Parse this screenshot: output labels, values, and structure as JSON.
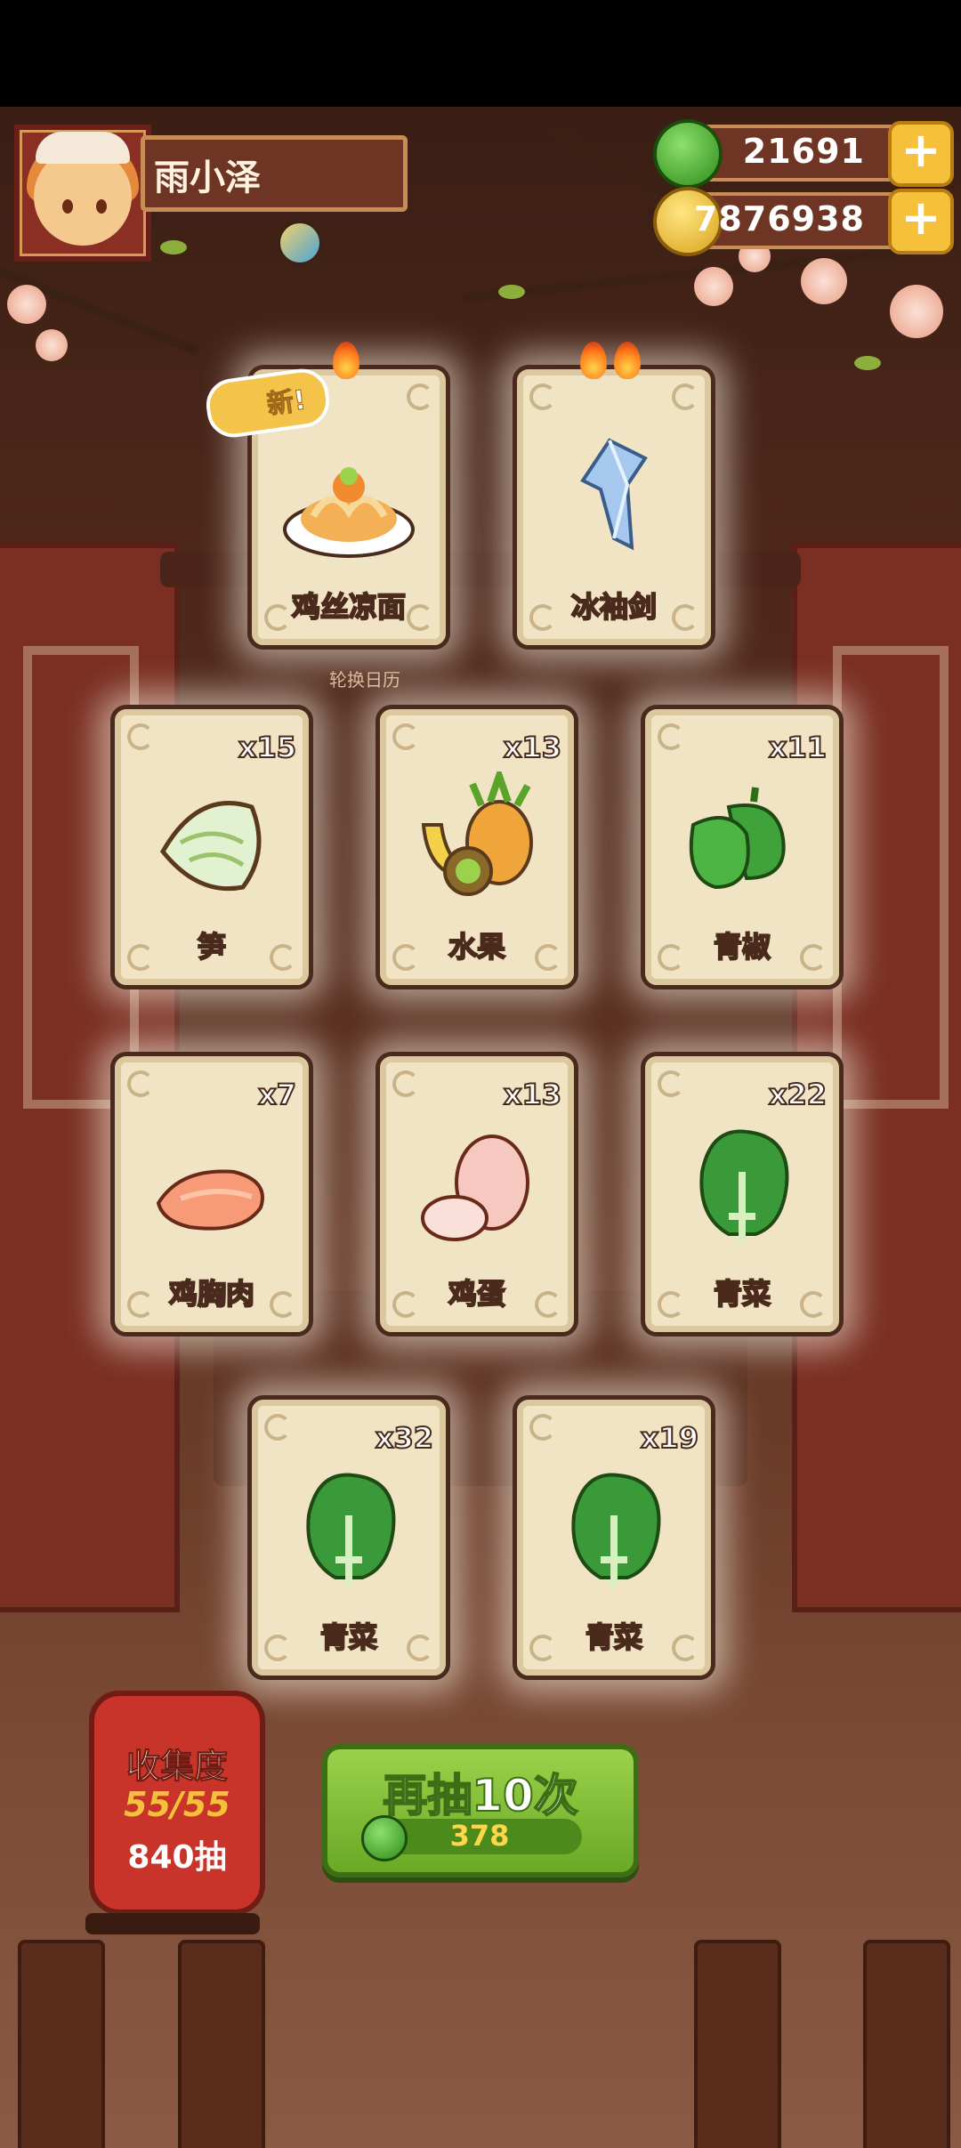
{
  "player": {
    "name": "雨小泽"
  },
  "currencies": {
    "jade": {
      "value": "21691",
      "icon": "green-gem-icon"
    },
    "coins": {
      "value": "7876938",
      "icon": "copper-coin-icon"
    }
  },
  "top_cards": [
    {
      "label": "鸡丝凉面",
      "flames": 1,
      "is_new": true,
      "art": "noodle-dish-icon"
    },
    {
      "label": "冰袖剑",
      "flames": 2,
      "is_new": false,
      "art": "ice-crystal-icon"
    }
  ],
  "new_badge": "新!",
  "sub_label": "轮换日历",
  "grid_cards": [
    {
      "label": "笋",
      "count": "x15",
      "art": "bamboo-shoot-icon"
    },
    {
      "label": "水果",
      "count": "x13",
      "art": "fruit-icon"
    },
    {
      "label": "青椒",
      "count": "x11",
      "art": "green-pepper-icon"
    },
    {
      "label": "鸡胸肉",
      "count": "x7",
      "art": "chicken-breast-icon"
    },
    {
      "label": "鸡蛋",
      "count": "x13",
      "art": "egg-icon"
    },
    {
      "label": "青菜",
      "count": "x22",
      "art": "bok-choy-icon"
    },
    {
      "label": "青菜",
      "count": "x32",
      "art": "bok-choy-icon"
    },
    {
      "label": "青菜",
      "count": "x19",
      "art": "bok-choy-icon"
    }
  ],
  "collection": {
    "title": "收集度",
    "progress": "55/55",
    "draws": "840抽"
  },
  "draw_button": {
    "label": "再抽10次",
    "cost": "378"
  },
  "colors": {
    "card_bg": "#f1e4c4",
    "card_border": "#4a2a1c",
    "button_green": "#6aa826",
    "lantern_red": "#c8342a"
  }
}
